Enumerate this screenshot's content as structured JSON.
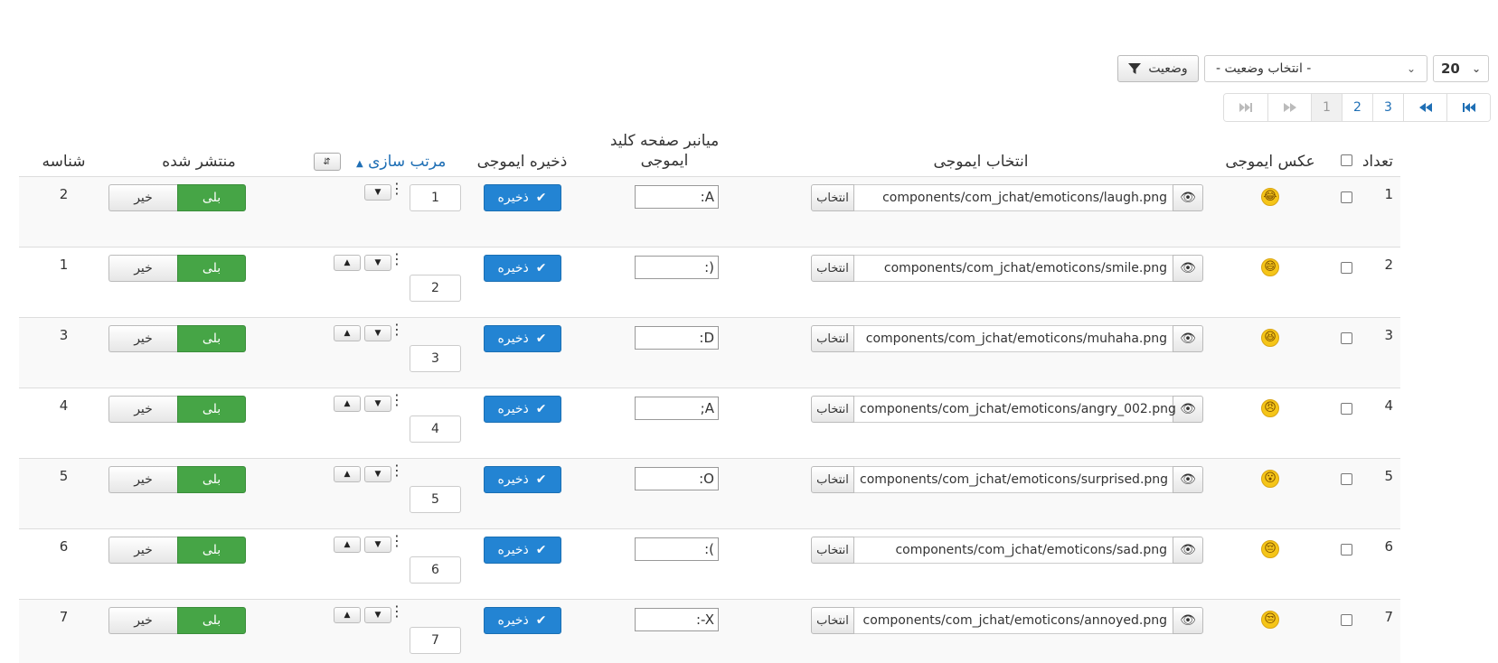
{
  "toolbar": {
    "limit_value": "20",
    "status_select": "- انتخاب وضعیت -",
    "filter_label": "وضعیت"
  },
  "pagination": {
    "first": "⏮",
    "prev": "⏪",
    "pages": [
      "3",
      "2",
      "1"
    ],
    "active_page": "1",
    "next": "⏩",
    "last": "⏭"
  },
  "table": {
    "headers": {
      "num": "تعداد",
      "image": "عکس ایموجی",
      "choose": "انتخاب ایموجی",
      "shortcut": "میانبر صفحه کلید ایموجی",
      "save": "ذخیره ایموجی",
      "ordering": "مرتب سازی",
      "published": "منتشر شده",
      "id": "شناسه"
    },
    "choose_label": "انتخاب",
    "save_label": "ذخیره",
    "yes_label": "بلی",
    "no_label": "خیر",
    "rows": [
      {
        "num": "1",
        "emoji": "😂",
        "path": "components/com_jchat/emoticons/laugh.png",
        "key": ":A",
        "order": "1",
        "id": "2"
      },
      {
        "num": "2",
        "emoji": "😄",
        "path": "components/com_jchat/emoticons/smile.png",
        "key": ":)",
        "order": "2",
        "id": "1"
      },
      {
        "num": "3",
        "emoji": "😆",
        "path": "components/com_jchat/emoticons/muhaha.png",
        "key": ":D",
        "order": "3",
        "id": "3"
      },
      {
        "num": "4",
        "emoji": "😠",
        "path": "components/com_jchat/emoticons/angry_002.png",
        "key": ";A",
        "order": "4",
        "id": "4"
      },
      {
        "num": "5",
        "emoji": "😮",
        "path": "components/com_jchat/emoticons/surprised.png",
        "key": ":O",
        "order": "5",
        "id": "5"
      },
      {
        "num": "6",
        "emoji": "😔",
        "path": "components/com_jchat/emoticons/sad.png",
        "key": ":(",
        "order": "6",
        "id": "6"
      },
      {
        "num": "7",
        "emoji": "😒",
        "path": "components/com_jchat/emoticons/annoyed.png",
        "key": ":-X",
        "order": "7",
        "id": "7"
      }
    ]
  }
}
